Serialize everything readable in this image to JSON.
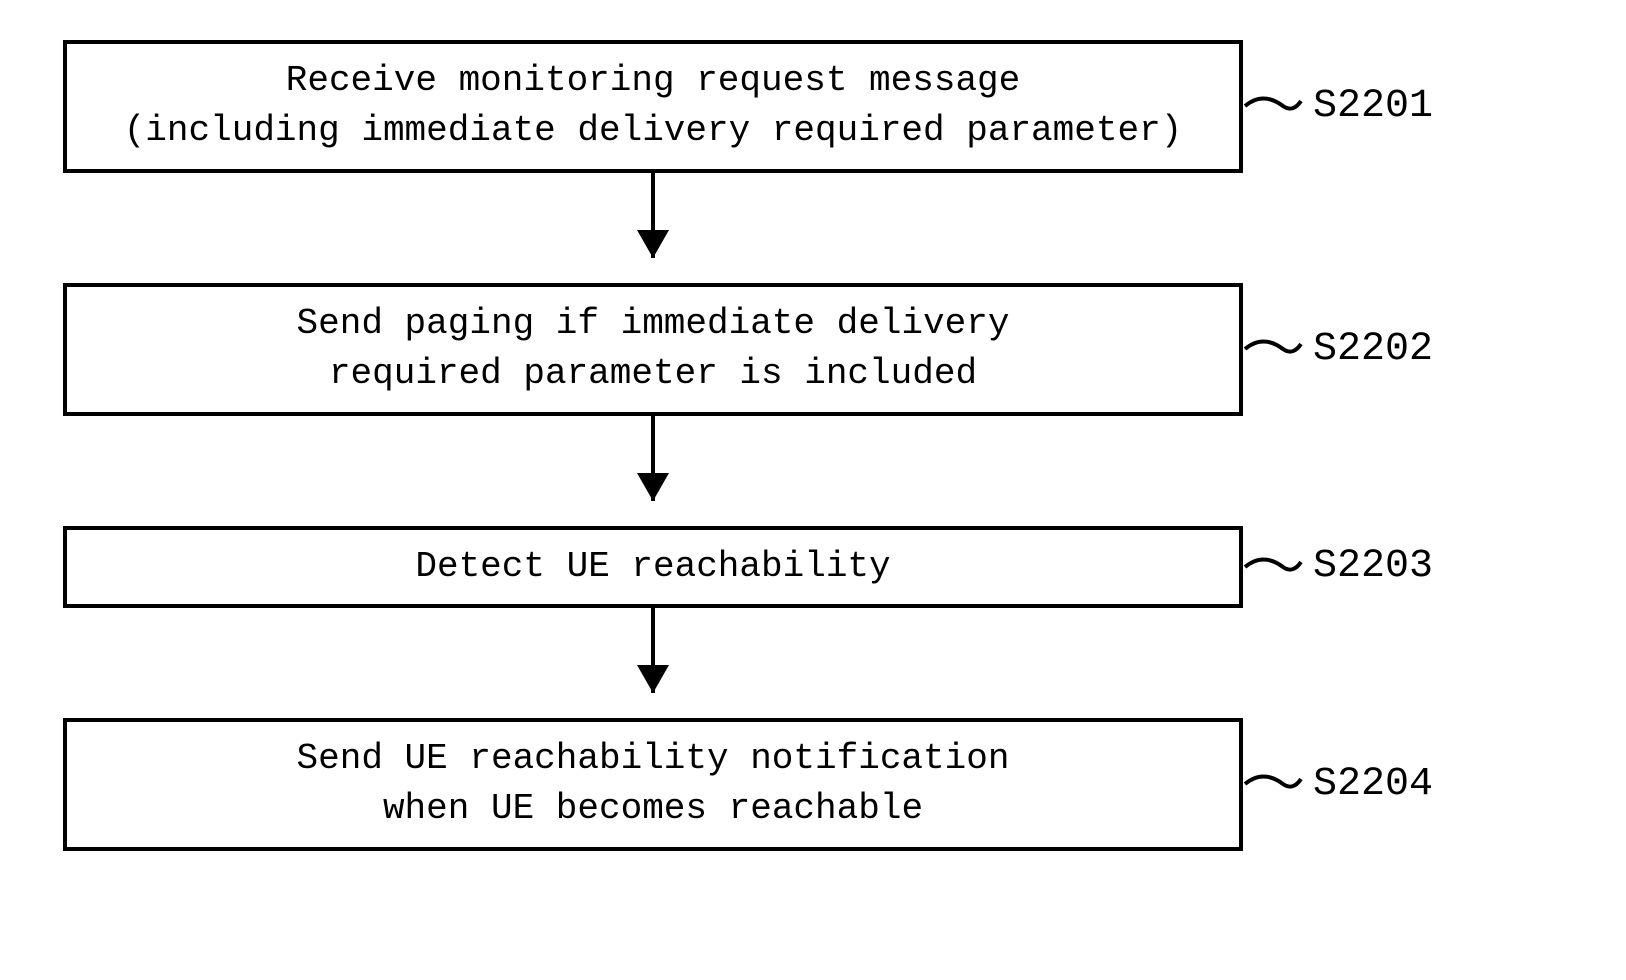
{
  "steps": [
    {
      "line1": "Receive monitoring request message",
      "line2": "(including immediate delivery required parameter)",
      "label": "S2201"
    },
    {
      "line1": "Send paging if immediate delivery",
      "line2": "required parameter is included",
      "label": "S2202"
    },
    {
      "line1": "Detect UE reachability",
      "line2": "",
      "label": "S2203"
    },
    {
      "line1": "Send UE reachability notification",
      "line2": "when UE becomes reachable",
      "label": "S2204"
    }
  ]
}
